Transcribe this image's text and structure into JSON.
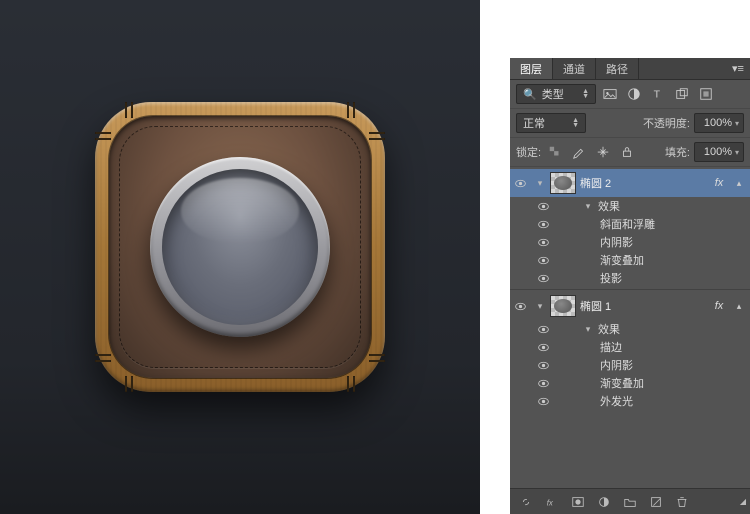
{
  "tabs": {
    "layers": "图层",
    "channels": "通道",
    "paths": "路径"
  },
  "filter": {
    "mode": "类型",
    "search_icon": "search-icon"
  },
  "blend": {
    "mode": "正常",
    "opacity_label": "不透明度:",
    "opacity_value": "100%"
  },
  "lock": {
    "label": "锁定:",
    "fill_label": "填充:",
    "fill_value": "100%"
  },
  "layers_list": [
    {
      "name": "椭圆 2",
      "selected": true,
      "has_fx": true,
      "expanded": true,
      "effects_label": "效果",
      "effects": [
        "斜面和浮雕",
        "内阴影",
        "渐变叠加",
        "投影"
      ]
    },
    {
      "name": "椭圆 1",
      "selected": false,
      "has_fx": true,
      "expanded": true,
      "effects_label": "效果",
      "effects": [
        "描边",
        "内阴影",
        "渐变叠加",
        "外发光"
      ]
    }
  ],
  "icons": {
    "picture": "picture-icon",
    "adjust": "adjust-icon",
    "text": "text-icon",
    "shape": "shape-icon",
    "smart": "smart-icon",
    "link": "link-icon",
    "fx": "fx-icon",
    "mask": "mask-icon",
    "group": "group-folder-icon",
    "new": "new-layer-icon",
    "trash": "trash-icon",
    "fill": "fill-adjustment-icon"
  }
}
